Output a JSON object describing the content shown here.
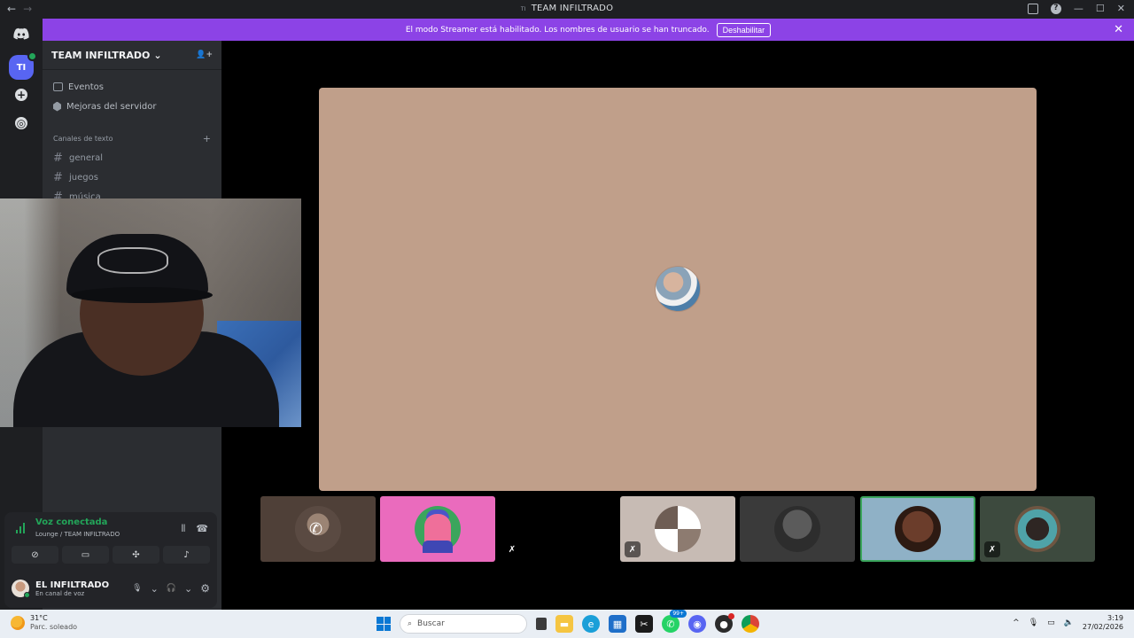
{
  "window": {
    "title": "TEAM INFILTRADO",
    "title_mini": "TI",
    "back": "←",
    "forward": "→",
    "help": "?",
    "minimize": "—",
    "maximize": "☐",
    "close": "✕"
  },
  "banner": {
    "text": "El modo Streamer está habilitado. Los nombres de usuario se han truncado.",
    "button": "Deshabilitar",
    "close": "✕",
    "color": "#8c43e6"
  },
  "rail": {
    "server_abbrev": "TI",
    "add": "+",
    "explore": "◎"
  },
  "server": {
    "name": "TEAM INFILTRADO",
    "chevron": "⌄",
    "invite": "👤+",
    "items": [
      {
        "label": "Eventos",
        "icon": "calendar-icon"
      },
      {
        "label": "Mejoras del servidor",
        "icon": "boost-icon"
      }
    ],
    "category": "Canales de texto",
    "category_add": "+",
    "channels": [
      "general",
      "juegos",
      "música"
    ]
  },
  "voice": {
    "status": "Voz conectada",
    "channel": "Lounge / TEAM INFILTRADO",
    "status_color": "#23a559",
    "noise": "⫴",
    "disconnect": "☎"
  },
  "user": {
    "name": "EL INFILTRADO",
    "status": "En canal de voz",
    "mic": "🎙",
    "chev1": "⌄",
    "headset": "🎧",
    "chev2": "⌄",
    "settings": "⚙"
  },
  "taskbar": {
    "weather_temp": "31°C",
    "weather_desc": "Parc. soleado",
    "search_placeholder": "Buscar",
    "whatsapp_badge": "99+",
    "time": "3:19",
    "date": "27/02/2026",
    "tray_up": "^"
  }
}
